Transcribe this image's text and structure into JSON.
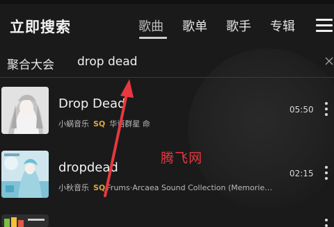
{
  "header": {
    "title": "立即搜索",
    "tabs": [
      "歌曲",
      "歌单",
      "歌手",
      "专辑"
    ],
    "active_tab_index": 0
  },
  "search": {
    "category": "聚合大会",
    "query": "drop dead"
  },
  "results": [
    {
      "title": "Drop Dead",
      "source": "小蜗音乐",
      "quality": "SQ",
      "artist": "华语群星 命",
      "duration": "05:50"
    },
    {
      "title": "dropdead",
      "source": "小秋音乐",
      "quality": "SQ",
      "artist": "Frums·Arcaea Sound Collection (Memorie…",
      "duration": "02:15"
    }
  ],
  "watermark": "腾飞网",
  "colors": {
    "background": "#1a1a1a",
    "quality_badge": "#e0a53a",
    "watermark": "#e8383f",
    "annotation_arrow": "#e8383f"
  }
}
